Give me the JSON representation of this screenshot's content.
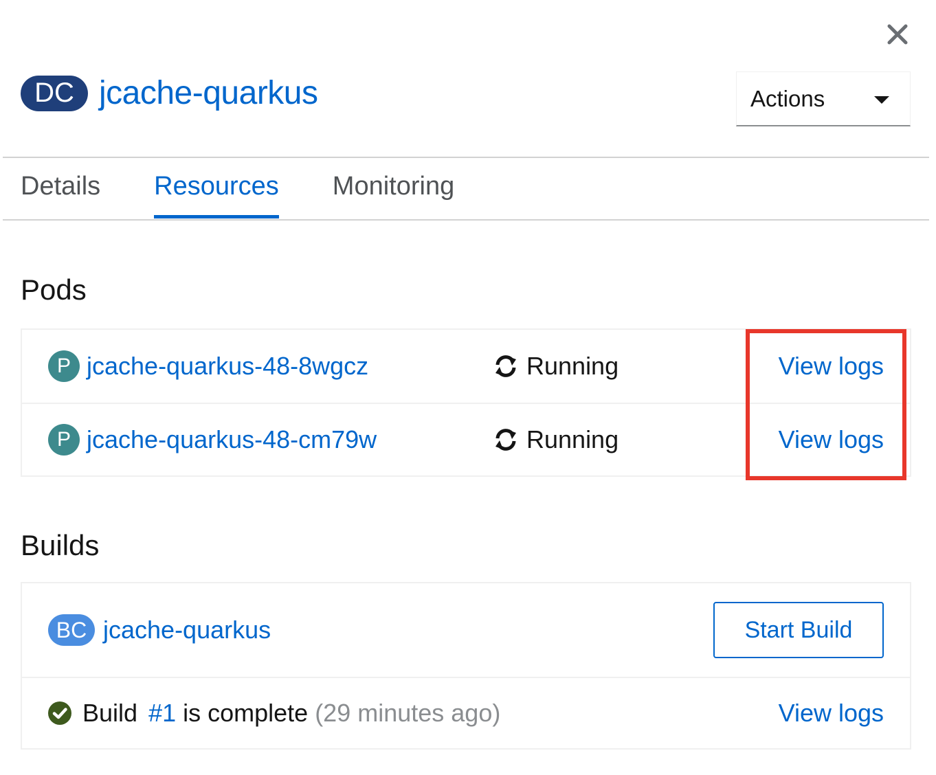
{
  "header": {
    "kind_badge": "DC",
    "title": "jcache-quarkus",
    "actions_label": "Actions",
    "close_icon": "close-icon"
  },
  "tabs": [
    {
      "label": "Details",
      "active": false
    },
    {
      "label": "Resources",
      "active": true
    },
    {
      "label": "Monitoring",
      "active": false
    }
  ],
  "pods": {
    "heading": "Pods",
    "items": [
      {
        "badge": "P",
        "name": "jcache-quarkus-48-8wgcz",
        "status": "Running",
        "action": "View logs"
      },
      {
        "badge": "P",
        "name": "jcache-quarkus-48-cm79w",
        "status": "Running",
        "action": "View logs"
      }
    ]
  },
  "builds": {
    "heading": "Builds",
    "config": {
      "badge": "BC",
      "name": "jcache-quarkus",
      "button": "Start Build"
    },
    "latest": {
      "prefix": "Build",
      "number": "#1",
      "text": "is complete",
      "time": "(29 minutes ago)",
      "action": "View logs"
    }
  },
  "colors": {
    "link": "#0066cc",
    "dc_badge": "#1f3f7a",
    "pod_badge": "#3d8a8d",
    "bc_badge": "#4a8de0",
    "success": "#3e8635",
    "highlight": "#e8372b"
  }
}
